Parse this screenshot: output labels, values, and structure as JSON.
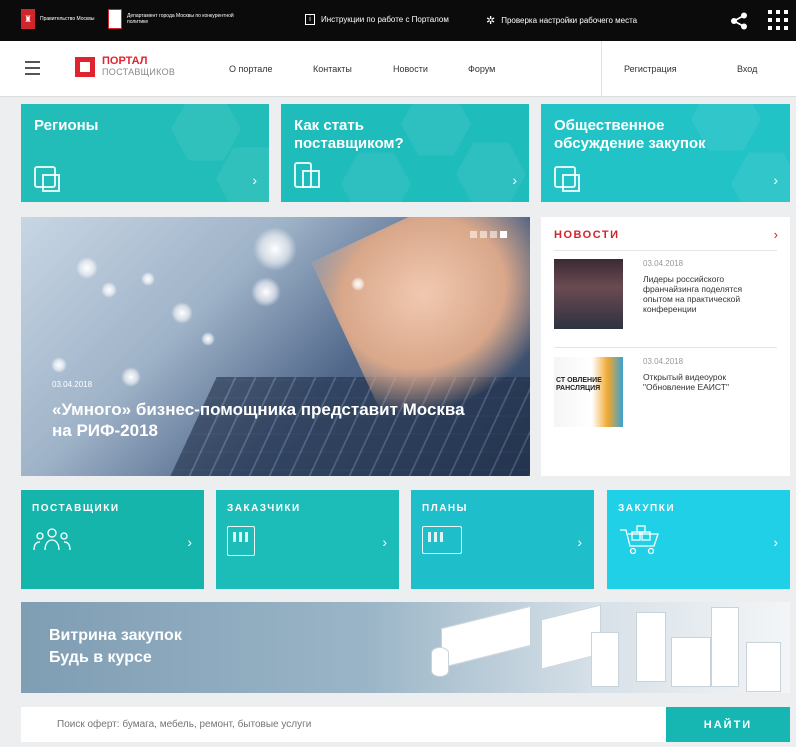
{
  "topbar": {
    "gov_moscow": "Правительство Москвы",
    "dept": "Департамент города Москвы по конкурентной политике",
    "instructions": "Инструкции по работе с Порталом",
    "workplace_check": "Проверка настройки рабочего места"
  },
  "header": {
    "logo_line1": "ПОРТАЛ",
    "logo_line2": "ПОСТАВЩИКОВ",
    "nav": [
      "О портале",
      "Контакты",
      "Новости",
      "Форум"
    ],
    "register": "Регистрация",
    "login": "Вход"
  },
  "tiles": [
    {
      "title": "Регионы",
      "color": "#22bdb8"
    },
    {
      "title": "Как стать поставщиком?",
      "color": "#1fbcbc"
    },
    {
      "title": "Общественное обсуждение закупок",
      "color": "#22c3c6"
    }
  ],
  "hero": {
    "date": "03.04.2018",
    "title": "«Умного» бизнес-помощника представит Москва на РИФ-2018",
    "slides": 4,
    "active_slide": 4
  },
  "news": {
    "heading": "НОВОСТИ",
    "items": [
      {
        "date": "03.04.2018",
        "text": "Лидеры российского франчайзинга поделятся опытом на практической конференции",
        "image_text": ""
      },
      {
        "date": "03.04.2018",
        "text": "Открытый видеоурок \"Обновление ЕАИСТ\"",
        "image_text": "СТ ОВЛЕНИЕ РАНСЛЯЦИЯ"
      }
    ]
  },
  "categories": [
    {
      "label": "ПОСТАВЩИКИ",
      "color": "#16b5ab",
      "icon": "people-icon"
    },
    {
      "label": "ЗАКАЗЧИКИ",
      "color": "#1cbdb8",
      "icon": "building-icon"
    },
    {
      "label": "ПЛАНЫ",
      "color": "#1ebecb",
      "icon": "calendar-icon"
    },
    {
      "label": "ЗАКУПКИ",
      "color": "#1fd0e6",
      "icon": "cart-icon"
    }
  ],
  "banner": {
    "line1": "Витрина закупок",
    "line2": "Будь в курсе"
  },
  "search": {
    "placeholder": "Поиск оферт: бумага, мебель, ремонт, бытовые услуги",
    "button": "НАЙТИ"
  }
}
